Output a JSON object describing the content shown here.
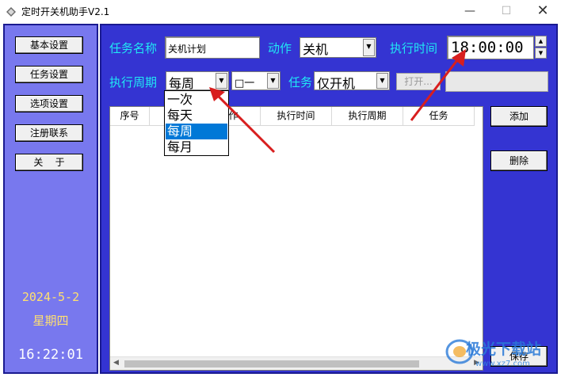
{
  "window": {
    "title": "定时开关机助手V2.1",
    "minimize": "—",
    "maximize": "☐",
    "close": "✕"
  },
  "sidebar": {
    "buttons": [
      {
        "label": "基本设置"
      },
      {
        "label": "任务设置"
      },
      {
        "label": "选项设置"
      },
      {
        "label": "注册联系"
      },
      {
        "label": "关    于"
      }
    ],
    "date": "2024-5-2",
    "weekday": "星期四",
    "clock": "16:22:01"
  },
  "form": {
    "task_name_label": "任务名称",
    "task_name_value": "关机计划",
    "action_label": "动作",
    "action_value": "关机",
    "exec_time_label": "执行时间",
    "exec_time_value": "18:00:00",
    "period_label": "执行周期",
    "period_value": "每周",
    "sub_period_value": "□一",
    "task_label": "任务",
    "task_value": "仅开机",
    "open_button": "打开..."
  },
  "period_dropdown": {
    "options": [
      "一次",
      "每天",
      "每周",
      "每月"
    ],
    "selected": "每周"
  },
  "table": {
    "columns": [
      "序号",
      "",
      "动作",
      "执行时间",
      "执行周期",
      "任务"
    ]
  },
  "actions": {
    "add": "添加",
    "delete": "删除",
    "save": "保存"
  },
  "watermark": {
    "name": "极光下载站",
    "url": "www.xz7.com"
  },
  "colors": {
    "main_bg": "#3434d2",
    "sidebar_bg": "#7878ee",
    "label_cyan": "#20e8f4",
    "date_yellow": "#ffe070",
    "annotation_red": "#d81e1e"
  }
}
